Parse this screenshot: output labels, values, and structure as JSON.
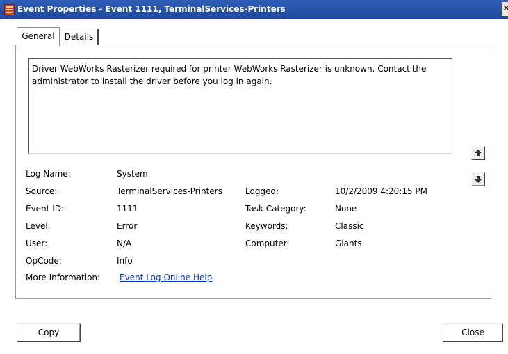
{
  "window": {
    "title": "Event Properties - Event 1111, TerminalServices-Printers",
    "close_glyph": "✕"
  },
  "tabs": [
    {
      "label": "General",
      "active": true
    },
    {
      "label": "Details",
      "active": false
    }
  ],
  "description": "Driver WebWorks Rasterizer required for printer WebWorks Rasterizer is unknown. Contact the administrator to install the driver before you log in again.",
  "fields": {
    "log_name": {
      "label": "Log Name:",
      "value": "System"
    },
    "source": {
      "label": "Source:",
      "value": "TerminalServices-Printers"
    },
    "logged": {
      "label": "Logged:",
      "value": "10/2/2009 4:20:15 PM"
    },
    "event_id": {
      "label": "Event ID:",
      "value": "1111"
    },
    "task_category": {
      "label": "Task Category:",
      "value": "None"
    },
    "level": {
      "label": "Level:",
      "value": "Error"
    },
    "keywords": {
      "label": "Keywords:",
      "value": "Classic"
    },
    "user": {
      "label": "User:",
      "value": "N/A"
    },
    "computer": {
      "label": "Computer:",
      "value": "Giants"
    },
    "opcode": {
      "label": "OpCode:",
      "value": "Info"
    },
    "more_info": {
      "label": "More Information:",
      "link": "Event Log Online Help"
    }
  },
  "nav": {
    "up_icon": "arrow-up-icon",
    "down_icon": "arrow-down-icon"
  },
  "buttons": {
    "copy": "Copy",
    "close": "Close"
  },
  "colors": {
    "titlebar": "#2f5fb7",
    "link": "#0033cc"
  }
}
